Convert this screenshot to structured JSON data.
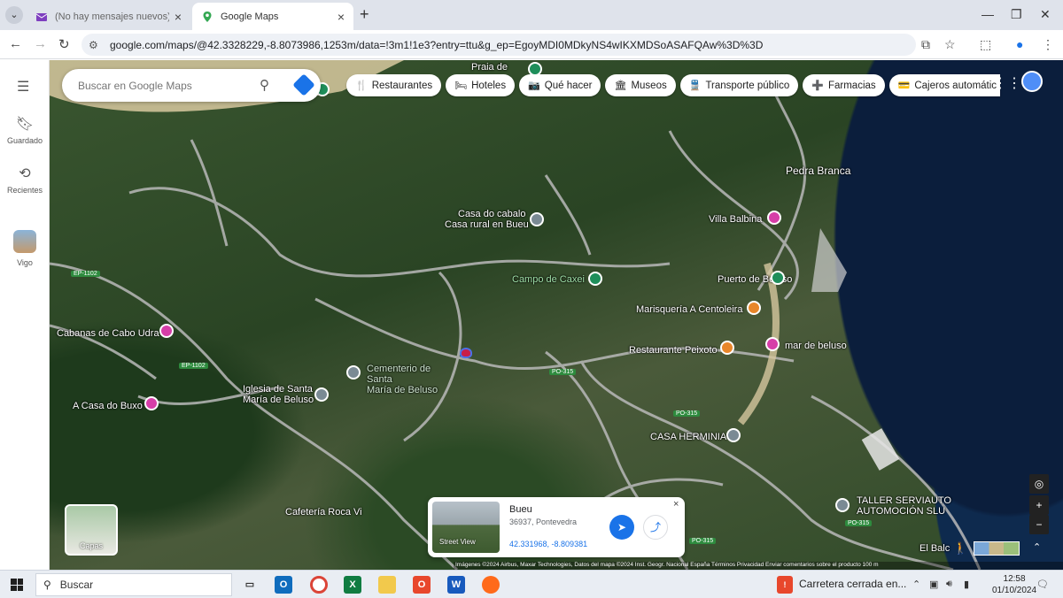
{
  "browser": {
    "tabs": [
      {
        "title": "(No hay mensajes nuevos) - ",
        "active": false
      },
      {
        "title": "Google Maps",
        "active": true
      }
    ],
    "new_tab": "+",
    "url": "google.com/maps/@42.3328229,-8.8073986,1253m/data=!3m1!1e3?entry=ttu&g_ep=EgoyMDI0MDkyNS4wIKXMDSoASAFQAw%3D%3D"
  },
  "rail": {
    "saved_label": "Guardado",
    "recent_label": "Recientes",
    "vigo_label": "Vigo"
  },
  "search": {
    "placeholder": "Buscar en Google Maps"
  },
  "chips": [
    {
      "label": "Restaurantes",
      "icon": "🍴"
    },
    {
      "label": "Hoteles",
      "icon": "🛏"
    },
    {
      "label": "Qué hacer",
      "icon": "📷"
    },
    {
      "label": "Museos",
      "icon": "🏛"
    },
    {
      "label": "Transporte público",
      "icon": "🚆"
    },
    {
      "label": "Farmacias",
      "icon": "➕"
    },
    {
      "label": "Cajeros automátic",
      "icon": "💳"
    }
  ],
  "map": {
    "places": {
      "praia": "Praia de",
      "casa_cabalo": "Casa do cabalo",
      "casa_rural": "Casa rural en Bueu",
      "villa_balbina": "Villa Balbina",
      "pedra_branca": "Pedra Branca",
      "campo_caxei": "Campo de Caxei",
      "puerto_beluso": "Puerto de Beluso",
      "marisqueria": "Marisquería A Centoleira",
      "restaurante": "Restaurante Peixoto",
      "mar_beluso": "mar de beluso",
      "cabanas": "Cabanas de Cabo Udra",
      "cementerio": "Cementerio de Santa\nMaría de Beluso",
      "iglesia": "Iglesia de Santa\nMaría de Beluso",
      "casa_buxo": "A Casa do Buxo",
      "casa_herminia": "CASA HERMINIA",
      "taller": "TALLER SERVIAUTO\nAUTOMOCIÓN SLU",
      "cafeteria": "Cafetería Roca Vi",
      "el_balc": "El Balc"
    },
    "road_badges": [
      "EP-1102",
      "EP-1102",
      "PO-315",
      "PO-315",
      "PO-315",
      "PO-315"
    ]
  },
  "layers_label": "Capas",
  "card": {
    "name": "Bueu",
    "address": "36937, Pontevedra",
    "coords": "42.331968, -8.809381",
    "street_view": "Street View",
    "close": "×"
  },
  "attribution": "Imágenes ©2024 Airbus, Maxar Technologies, Datos del mapa ©2024 Inst. Geogr. Nacional     España     Términos     Privacidad     Enviar comentarios sobre el producto     100 m",
  "taskbar": {
    "search_label": "Buscar",
    "notice": "Carretera cerrada en...",
    "time": "12:58",
    "date": "01/10/2024"
  }
}
